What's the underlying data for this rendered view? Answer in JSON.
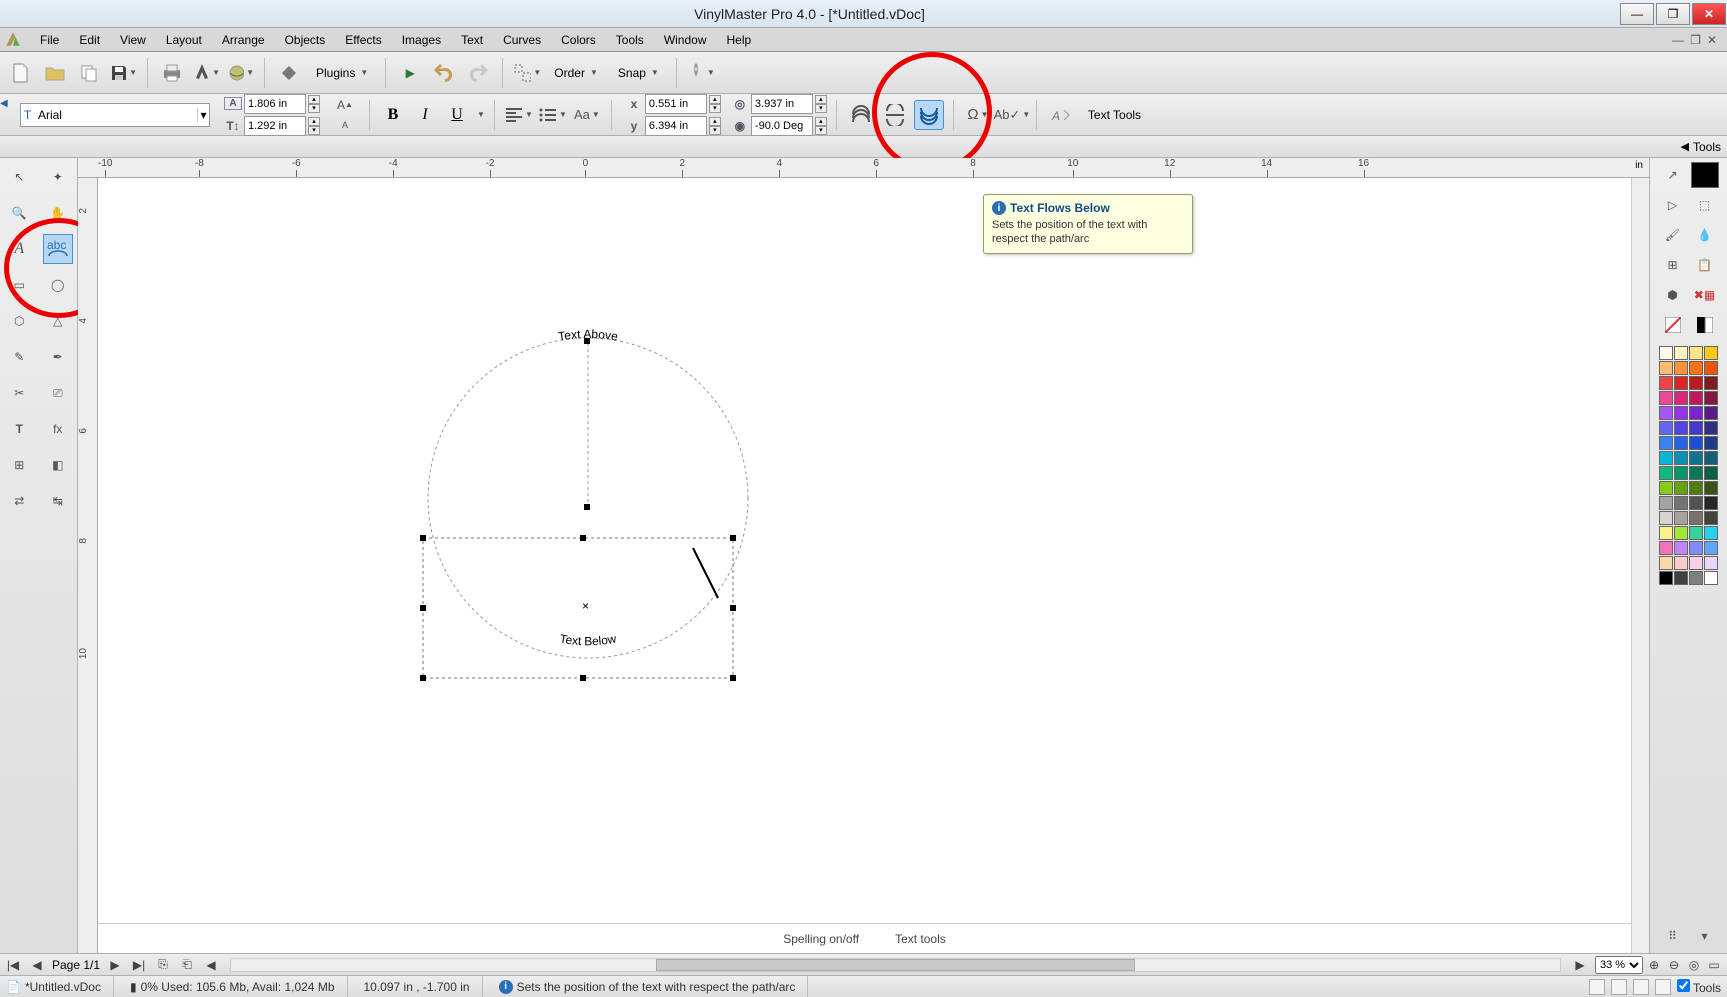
{
  "title": "VinylMaster Pro 4.0 - [*Untitled.vDoc]",
  "menus": [
    "File",
    "Edit",
    "View",
    "Layout",
    "Arrange",
    "Objects",
    "Effects",
    "Images",
    "Text",
    "Curves",
    "Colors",
    "Tools",
    "Window",
    "Help"
  ],
  "toolbar1": {
    "plugins_label": "Plugins",
    "order_label": "Order",
    "snap_label": "Snap"
  },
  "font": {
    "name": "Arial"
  },
  "dims": {
    "width": "1.806 in",
    "height": "1.292 in"
  },
  "position": {
    "x_label": "x",
    "x": "0.551 in",
    "y_label": "y",
    "y": "6.394 in",
    "lock_w": "3.937 in",
    "angle": "-90.0 Deg"
  },
  "text_tools_label": "Text Tools",
  "ruler_h": {
    "marks": [
      -10,
      -8,
      -6,
      -4,
      -2,
      0,
      2,
      4,
      6,
      8,
      10,
      12,
      14,
      16
    ],
    "unit": "in"
  },
  "ruler_v": {
    "marks": [
      2,
      4,
      6,
      8,
      10
    ]
  },
  "canvas_text": {
    "above": "Text Above",
    "below": "Text Below"
  },
  "tooltip": {
    "title": "Text Flows Below",
    "body": "Sets the position of the text with respect the path/arc"
  },
  "context_links": {
    "a": "Spelling on/off",
    "b": "Text tools"
  },
  "page": {
    "label": "Page 1/1",
    "zoom": "33 %"
  },
  "status": {
    "doc": "*Untitled.vDoc",
    "mem": "0%  Used: 105.6 Mb, Avail: 1,024 Mb",
    "coords": "10.097 in , -1.700 in",
    "hint": "Sets the position of the text with respect the path/arc",
    "tools_label": "Tools"
  },
  "tools_tab_label": "Tools",
  "palette_colors": [
    "#fefbe9",
    "#fef3c7",
    "#fde68a",
    "#facc15",
    "#fdba74",
    "#fb923c",
    "#f97316",
    "#ea580c",
    "#ef4444",
    "#dc2626",
    "#b91c1c",
    "#7f1d1d",
    "#ec4899",
    "#db2777",
    "#be185d",
    "#831843",
    "#a855f7",
    "#9333ea",
    "#7e22ce",
    "#581c87",
    "#6366f1",
    "#4f46e5",
    "#4338ca",
    "#312e81",
    "#3b82f6",
    "#2563eb",
    "#1d4ed8",
    "#1e3a8a",
    "#06b6d4",
    "#0891b2",
    "#0e7490",
    "#155e75",
    "#10b981",
    "#059669",
    "#047857",
    "#065f46",
    "#84cc16",
    "#65a30d",
    "#4d7c0f",
    "#365314",
    "#a3a3a3",
    "#737373",
    "#525252",
    "#262626",
    "#d6d3d1",
    "#a8a29e",
    "#78716c",
    "#44403c",
    "#fef08a",
    "#a3e635",
    "#34d399",
    "#22d3ee",
    "#f472b6",
    "#c084fc",
    "#818cf8",
    "#60a5fa",
    "#fed7aa",
    "#fecaca",
    "#fbcfe8",
    "#e9d5ff",
    "#000000",
    "#404040",
    "#808080",
    "#ffffff"
  ]
}
